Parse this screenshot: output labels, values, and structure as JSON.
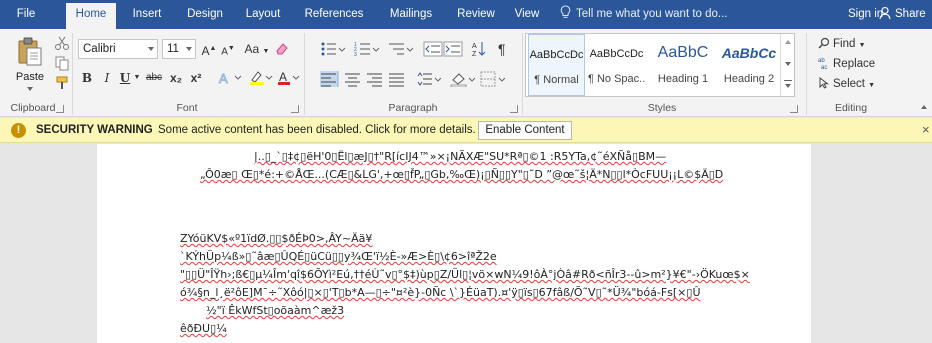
{
  "tabs": {
    "file": "File",
    "home": "Home",
    "insert": "Insert",
    "design": "Design",
    "layout": "Layout",
    "references": "References",
    "mailings": "Mailings",
    "review": "Review",
    "view": "View"
  },
  "tell_me": "Tell me what you want to do...",
  "sign_in": "Sign in",
  "share": "Share",
  "clipboard": {
    "paste": "Paste",
    "label": "Clipboard"
  },
  "font": {
    "name": "Calibri",
    "size": "11",
    "change_case": "Aa",
    "label": "Font",
    "bold": "B",
    "italic": "I",
    "underline": "U",
    "strike": "abc",
    "subscript": "x₂",
    "superscript": "x²"
  },
  "paragraph": {
    "label": "Paragraph"
  },
  "styles": {
    "label": "Styles",
    "items": [
      {
        "preview": "AaBbCcDc",
        "name": "¶ Normal"
      },
      {
        "preview": "AaBbCcDc",
        "name": "¶ No Spac..."
      },
      {
        "preview": "AaBbC",
        "name": "Heading 1"
      },
      {
        "preview": "AaBbCc",
        "name": "Heading 2"
      }
    ]
  },
  "editing": {
    "label": "Editing",
    "find": "Find",
    "replace": "Replace",
    "select": "Select"
  },
  "security": {
    "title": "SECURITY WARNING",
    "message": "Some active content has been disabled. Click for more details.",
    "button": "Enable Content",
    "close": "×"
  },
  "document_lines": [
    "|..▯_`▯‡¢▯ëH'0▯Ël▯æJ▯†\"R[ícIJ4™»×¡NÃXÆ\"SU*Rª▯©1 :R5YTa,¢˜éXÑå▯BM—",
    "„Ô0æ▯ Œ▯*é:+©ÅŒ...(CÆ▯&LG',+œ▯f̌P„▯Gb,‰Œ)¡▯Ñ▯▯Y\"▯˜D ”@œ˜š¦Ä*N▯▯l*ÒcFUU¡¡L©$Ä▯D",
    "ZYóüKV$«º1ïdØ.▯▯$ðÉÞ0>,ÂY~Ää¥",
    "`KÝhÜp¼ß»▯˜âæ▯ÛQÉ▯üCü▯▯y¾Œ'ï½È-»Æ>È▯\\¢6>îªŽ2e",
    "\"▯▯Ü\"ÎŸh›;ß€▯µ¼Îm'qî$6ÕYì²Eú,††éÙ˜v▯°$‡)ùp▯Z/Ül▯¦vö×wN¼9!ôÀ°jÒâ#Rð<ñÎr3‑-û>m²}¥€\"‑›ÖKuœ$×",
    "ó¾§n_l¸ë²ôE]M¯÷˜Xôó|▯×▯'T▯b*A—▯÷\"¤²è}‑0Ñc \\`}ÉüaT).¤'ÿ▯ïs▯67fâß/Õ˜V▯˜*Ü¾\"bóá-Fs[×▯Û",
    "½\"ï ÊkWfSt▯oõaàm^æž3",
    "êðÐU▯¼"
  ]
}
